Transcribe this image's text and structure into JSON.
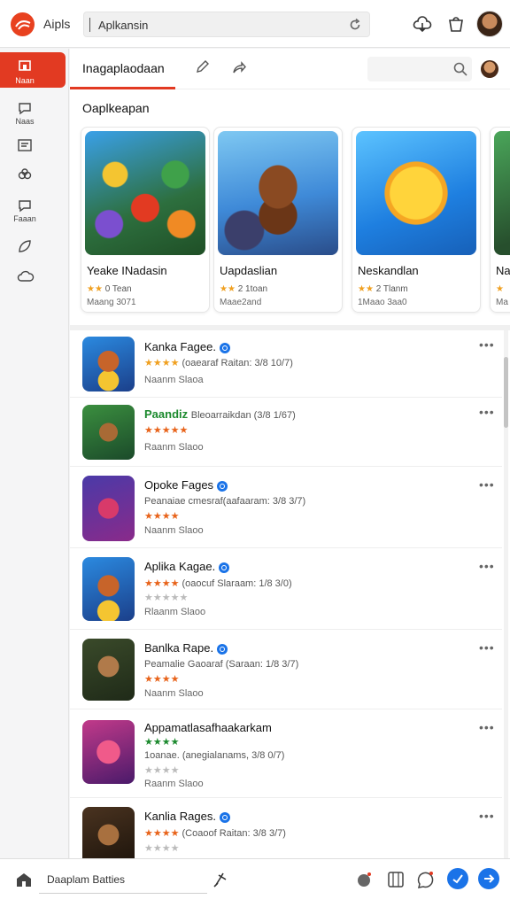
{
  "topbar": {
    "app_name": "Aipls",
    "search_value": "Aplkansin",
    "icons": [
      "app-logo-icon",
      "refresh-icon",
      "cloud-upload-icon",
      "bag-icon",
      "user-avatar"
    ]
  },
  "sidebar": {
    "items": [
      {
        "label": "Naan",
        "icon": "home-icon",
        "active": true
      },
      {
        "label": "Naas",
        "icon": "chat-icon"
      },
      {
        "label": "",
        "icon": "list-icon"
      },
      {
        "label": "",
        "icon": "gamepad-icon"
      },
      {
        "label": "Faaan",
        "icon": "message-icon"
      },
      {
        "label": "",
        "icon": "leaf-icon"
      },
      {
        "label": "",
        "icon": "cloud-icon"
      }
    ]
  },
  "tabs": {
    "active_label": "Inagaplaodaan",
    "icons": [
      "edit-icon",
      "share-icon",
      "search-icon",
      "profile-avatar"
    ]
  },
  "featured": {
    "section_title": "Oaplkeapan",
    "cards": [
      {
        "title": "Yeake INadasin",
        "rating": "0 Tean",
        "stars": 2,
        "sub": "Maang 3071"
      },
      {
        "title": "Uapdaslian",
        "rating": "2 1toan",
        "stars": 2,
        "sub": "Maae2and"
      },
      {
        "title": "Neskandlan",
        "rating": "2 Tlanm",
        "stars": 2,
        "sub": "1Maao 3aa0"
      },
      {
        "title": "Na",
        "rating": "",
        "stars": 1,
        "sub": "Ma"
      }
    ]
  },
  "list": {
    "items": [
      {
        "name": "Kanka Fagee.",
        "verified": true,
        "stars": 4,
        "meta": "(oaearaf Raitan: 3/8 10/7)",
        "sub": "Naanm Slaoa"
      },
      {
        "name": "Paandiz",
        "name_suffix": "Bleoarraikdan (3/8 1/67)",
        "verified": false,
        "stars": 5,
        "meta": "",
        "sub": "Raanm Slaoo"
      },
      {
        "name": "Opoke Fages",
        "verified": true,
        "stars": 4,
        "meta": "Peanaiae cmesraf(aafaaram: 3/8 3/7)",
        "sub": "Naanm Slaoo"
      },
      {
        "name": "Aplika Kagae.",
        "verified": true,
        "stars": 4,
        "meta": "(oaocuf Slaraam: 1/8 3/0)",
        "sub": "Rlaanm Slaoo"
      },
      {
        "name": "Banlka Rape.",
        "verified": true,
        "stars": 4,
        "meta": "Peamalie Gaoaraf (Saraan: 1/8 3/7)",
        "sub": "Naanm Slaoo"
      },
      {
        "name": "Appamatlasafhaakarkam",
        "verified": false,
        "stars": 4,
        "meta": "1oanae. (anegialanams, 3/8 0/7)",
        "sub": "Raanm Slaoo"
      },
      {
        "name": "Kanlia Rages.",
        "verified": true,
        "stars": 4,
        "meta": "(Coaoof Raitan: 3/8 3/7)",
        "sub": ""
      }
    ]
  },
  "bottombar": {
    "input_label": "Daaplam Batties",
    "icons": [
      "home-icon",
      "pin-icon",
      "speaker-icon",
      "grid-icon",
      "chat-icon",
      "send-icon",
      "arrow-icon"
    ]
  },
  "colors": {
    "accent": "#e23a22",
    "star": "#f0a020",
    "link_blue": "#1a73e8"
  }
}
